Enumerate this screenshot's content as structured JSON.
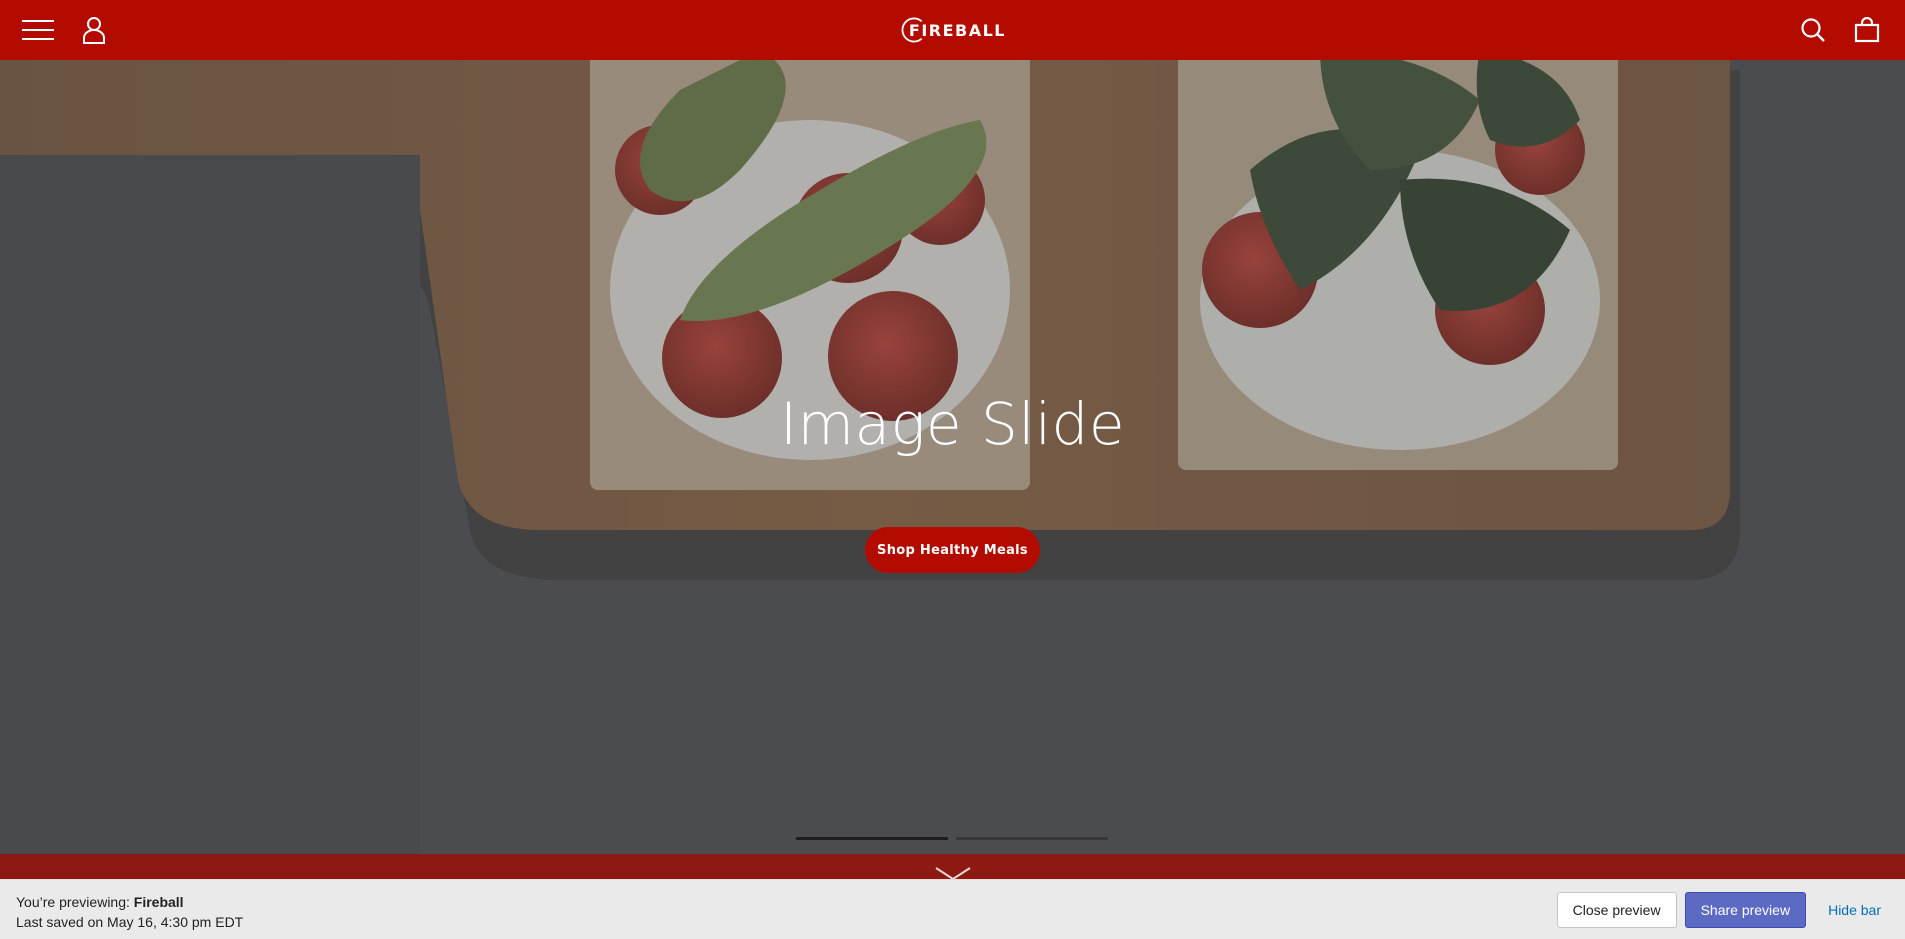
{
  "header": {
    "brand": "FIREBALL",
    "icons": {
      "menu": "hamburger-menu-icon",
      "account": "user-icon",
      "search": "search-icon",
      "cart": "shopping-bag-icon"
    },
    "color": "#b30b00"
  },
  "hero": {
    "title": "Image Slide",
    "cta_label": "Shop Healthy Meals",
    "slides_total": 2,
    "active_slide": 1
  },
  "preview_bar": {
    "previewing_prefix": "You’re previewing:",
    "theme_name": "Fireball",
    "last_saved": "Last saved on May 16, 4:30 pm EDT",
    "close_label": "Close preview",
    "share_label": "Share preview",
    "hide_label": "Hide bar"
  }
}
